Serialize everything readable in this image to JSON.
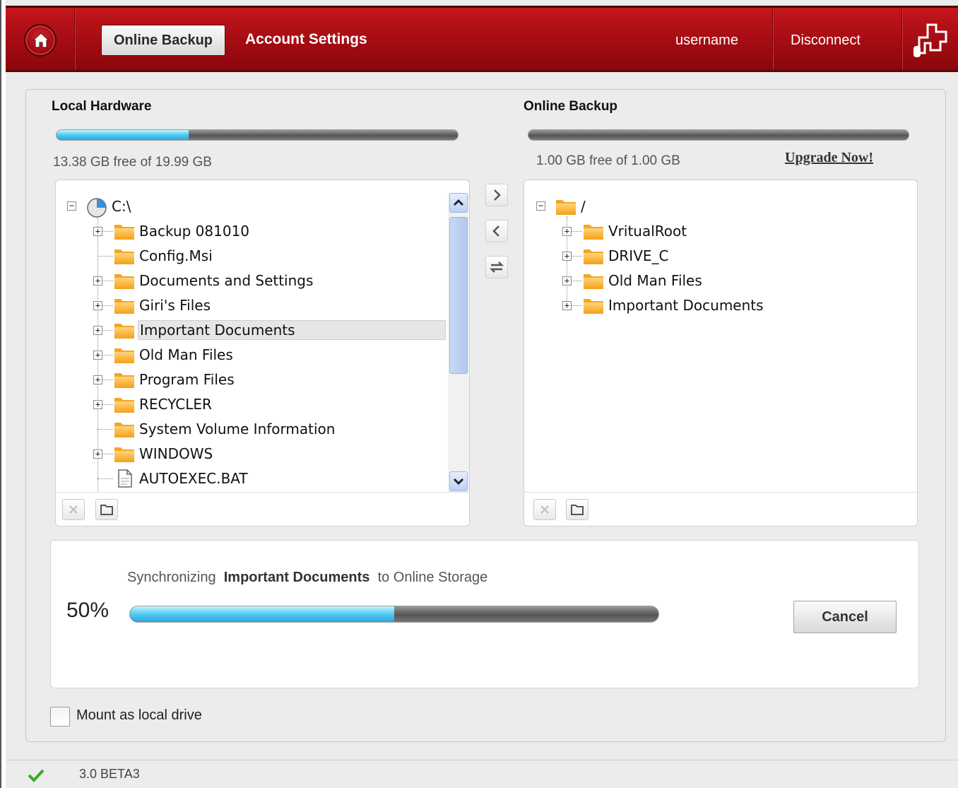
{
  "header": {
    "home_icon": "home-icon",
    "tabs": [
      {
        "label": "Online Backup",
        "active": true
      },
      {
        "label": "Account Settings",
        "active": false
      }
    ],
    "username": "username",
    "disconnect_label": "Disconnect",
    "plugin_icon": "plugin-icon",
    "brand_color": "#a40c12"
  },
  "local": {
    "title": "Local Hardware",
    "usage_fraction": 0.33,
    "free_text": "13.38  GB free of  19.99  GB",
    "tree": {
      "root": "C:\\",
      "items": [
        {
          "label": "Backup 081010",
          "type": "folder",
          "expandable": true
        },
        {
          "label": "Config.Msi",
          "type": "folder",
          "expandable": false
        },
        {
          "label": "Documents and Settings",
          "type": "folder",
          "expandable": true
        },
        {
          "label": "Giri's Files",
          "type": "folder",
          "expandable": true
        },
        {
          "label": "Important Documents",
          "type": "folder",
          "expandable": true,
          "selected": true
        },
        {
          "label": "Old Man Files",
          "type": "folder",
          "expandable": true
        },
        {
          "label": "Program Files",
          "type": "folder",
          "expandable": true
        },
        {
          "label": "RECYCLER",
          "type": "folder",
          "expandable": true
        },
        {
          "label": "System Volume Information",
          "type": "folder",
          "expandable": false
        },
        {
          "label": "WINDOWS",
          "type": "folder",
          "expandable": true
        },
        {
          "label": "AUTOEXEC.BAT",
          "type": "file",
          "expandable": false
        }
      ]
    }
  },
  "online": {
    "title": "Online Backup",
    "usage_fraction": 0.0,
    "free_text": "1.00  GB free of  1.00  GB",
    "upgrade_label": "Upgrade Now!",
    "tree": {
      "root": "/",
      "items": [
        {
          "label": "VritualRoot",
          "type": "folder",
          "expandable": true
        },
        {
          "label": "DRIVE_C",
          "type": "folder",
          "expandable": true
        },
        {
          "label": "Old Man Files",
          "type": "folder",
          "expandable": true
        },
        {
          "label": "Important Documents",
          "type": "folder",
          "expandable": true
        }
      ]
    }
  },
  "transfer": {
    "upload_icon": "chevron-right-icon",
    "download_icon": "chevron-left-icon",
    "sync_icon": "sync-icon"
  },
  "sync": {
    "prefix": "Synchronizing",
    "target": "Important Documents",
    "suffix": "to Online Storage",
    "percent_label": "50%",
    "progress_fraction": 0.5,
    "cancel_label": "Cancel"
  },
  "options": {
    "mount_label": "Mount as local drive",
    "mount_checked": false
  },
  "status": {
    "version": "3.0 BETA3",
    "status_icon": "check-icon"
  }
}
